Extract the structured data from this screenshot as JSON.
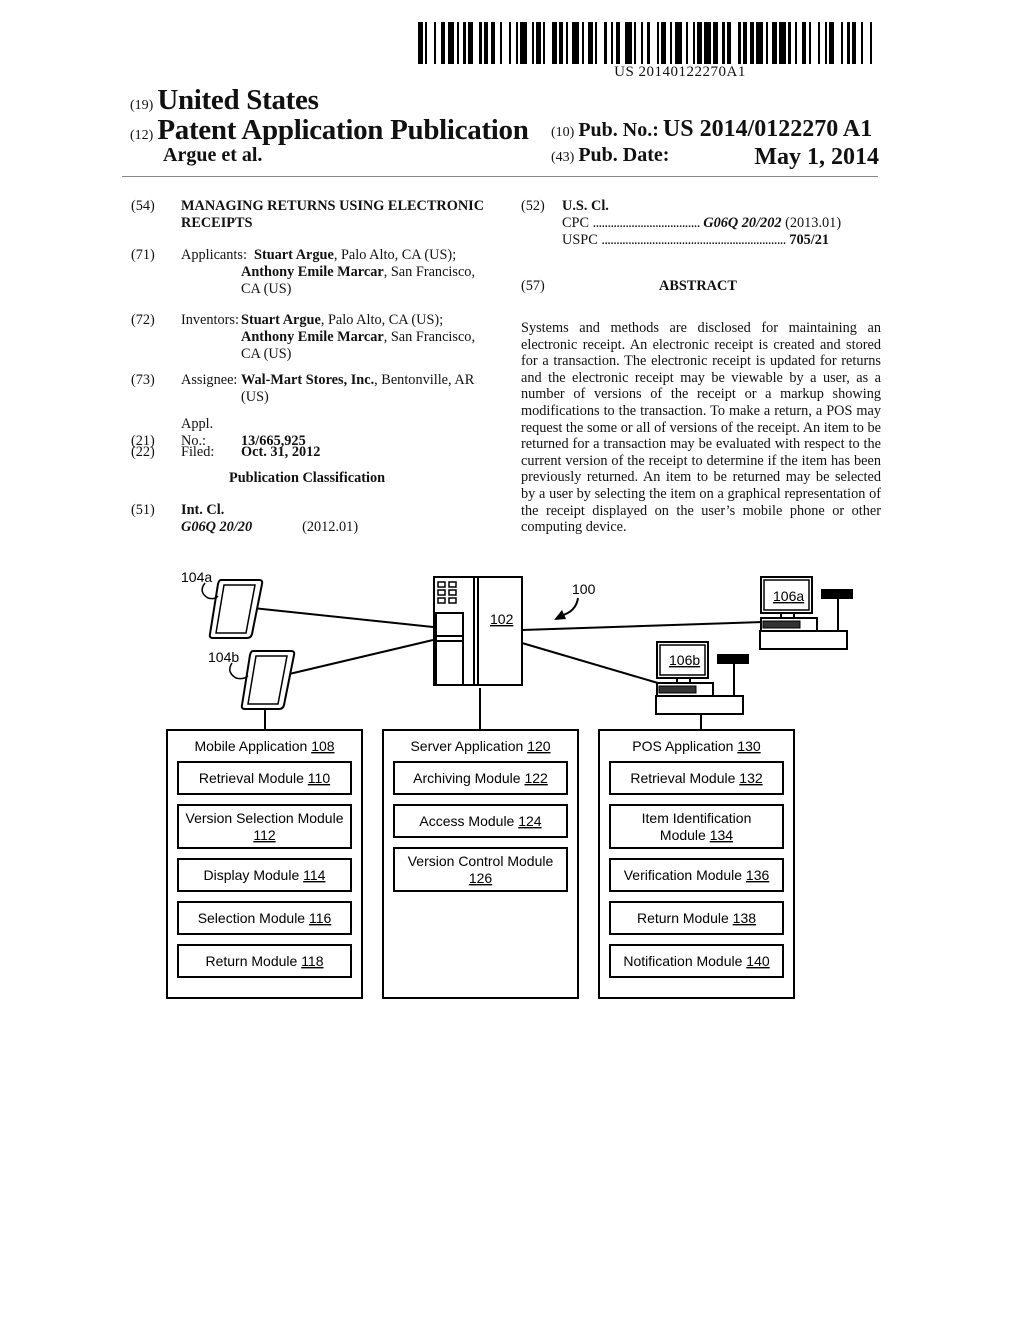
{
  "header": {
    "barcode_number": "US 20140122270A1",
    "country_tag": "(19)",
    "country": "United States",
    "type_tag": "(12)",
    "type": "Patent Application Publication",
    "authors": "Argue et al.",
    "pub_no_tag": "(10)",
    "pub_no_label": "Pub. No.:",
    "pub_no": "US 2014/0122270 A1",
    "pub_date_tag": "(43)",
    "pub_date_label": "Pub. Date:",
    "pub_date": "May 1, 2014"
  },
  "left_column": {
    "title": {
      "tag": "(54)",
      "line1": "MANAGING RETURNS USING ELECTRONIC",
      "line2": "RECEIPTS"
    },
    "applicants": {
      "tag": "(71)",
      "label": "Applicants:",
      "name1": "Stuart Argue",
      "loc1": ", Palo Alto, CA (US);",
      "name2": "Anthony Emile Marcar",
      "loc2": ", San Francisco,",
      "loc2b": "CA (US)"
    },
    "inventors": {
      "tag": "(72)",
      "label": "Inventors:",
      "name1": "Stuart Argue",
      "loc1": ", Palo Alto, CA (US);",
      "name2": "Anthony Emile Marcar",
      "loc2": ", San Francisco,",
      "loc2b": "CA (US)"
    },
    "assignee": {
      "tag": "(73)",
      "label": "Assignee:",
      "name": "Wal-Mart Stores, Inc.",
      "loc": ", Bentonville, AR",
      "loc2": "(US)"
    },
    "appl_no": {
      "tag": "(21)",
      "label": "Appl. No.:",
      "value": "13/665,925"
    },
    "filed": {
      "tag": "(22)",
      "label": "Filed:",
      "value": "Oct. 31, 2012"
    },
    "pub_class_heading": "Publication Classification",
    "int_cl": {
      "tag": "(51)",
      "label": "Int. Cl.",
      "code": "G06Q 20/20",
      "version": "(2012.01)"
    }
  },
  "right_column": {
    "us_cl": {
      "tag": "(52)",
      "label": "U.S. Cl.",
      "cpc_label": "CPC",
      "cpc_dots": "....................................",
      "cpc_code": "G06Q 20/202",
      "cpc_version": "(2013.01)",
      "uspc_label": "USPC",
      "uspc_dots": "..............................................................",
      "uspc_code": "705/21"
    },
    "abstract_tag": "(57)",
    "abstract_heading": "ABSTRACT",
    "abstract_text": "Systems and methods are disclosed for maintaining an electronic receipt. An electronic receipt is created and stored for a transaction. The electronic receipt is updated for returns and the electronic receipt may be viewable by a user, as a number of versions of the receipt or a markup showing modifications to the transaction. To make a return, a POS may request the some or all of versions of the receipt. An item to be returned for a transaction may be evaluated with respect to the current version of the receipt to determine if the item has been previously returned. An item to be returned may be selected by a user by selecting the item on a graphical representation of the receipt displayed on the user’s mobile phone or other computing device."
  },
  "figure": {
    "system_ref": "100",
    "server_ref": "102",
    "device_a": "104a",
    "device_b": "104b",
    "pos_a": "106a",
    "pos_b": "106b",
    "apps": [
      {
        "name": "Mobile Application",
        "ref": "108",
        "modules": [
          {
            "lines": [
              "Retrieval Module"
            ],
            "ref": "110"
          },
          {
            "lines": [
              "Version Selection Module"
            ],
            "ref": "112",
            "ref_newline": true
          },
          {
            "lines": [
              "Display Module"
            ],
            "ref": "114"
          },
          {
            "lines": [
              "Selection Module"
            ],
            "ref": "116"
          },
          {
            "lines": [
              "Return Module"
            ],
            "ref": "118"
          }
        ]
      },
      {
        "name": "Server Application",
        "ref": "120",
        "modules": [
          {
            "lines": [
              "Archiving Module"
            ],
            "ref": "122"
          },
          {
            "lines": [
              "Access Module"
            ],
            "ref": "124"
          },
          {
            "lines": [
              "Version Control Module"
            ],
            "ref": "126",
            "ref_newline": true
          }
        ]
      },
      {
        "name": "POS Application",
        "ref": "130",
        "modules": [
          {
            "lines": [
              "Retrieval Module"
            ],
            "ref": "132"
          },
          {
            "lines": [
              "Item Identification",
              "Module"
            ],
            "ref": "134"
          },
          {
            "lines": [
              "Verification Module"
            ],
            "ref": "136"
          },
          {
            "lines": [
              "Return Module"
            ],
            "ref": "138"
          },
          {
            "lines": [
              "Notification Module"
            ],
            "ref": "140"
          }
        ]
      }
    ]
  }
}
